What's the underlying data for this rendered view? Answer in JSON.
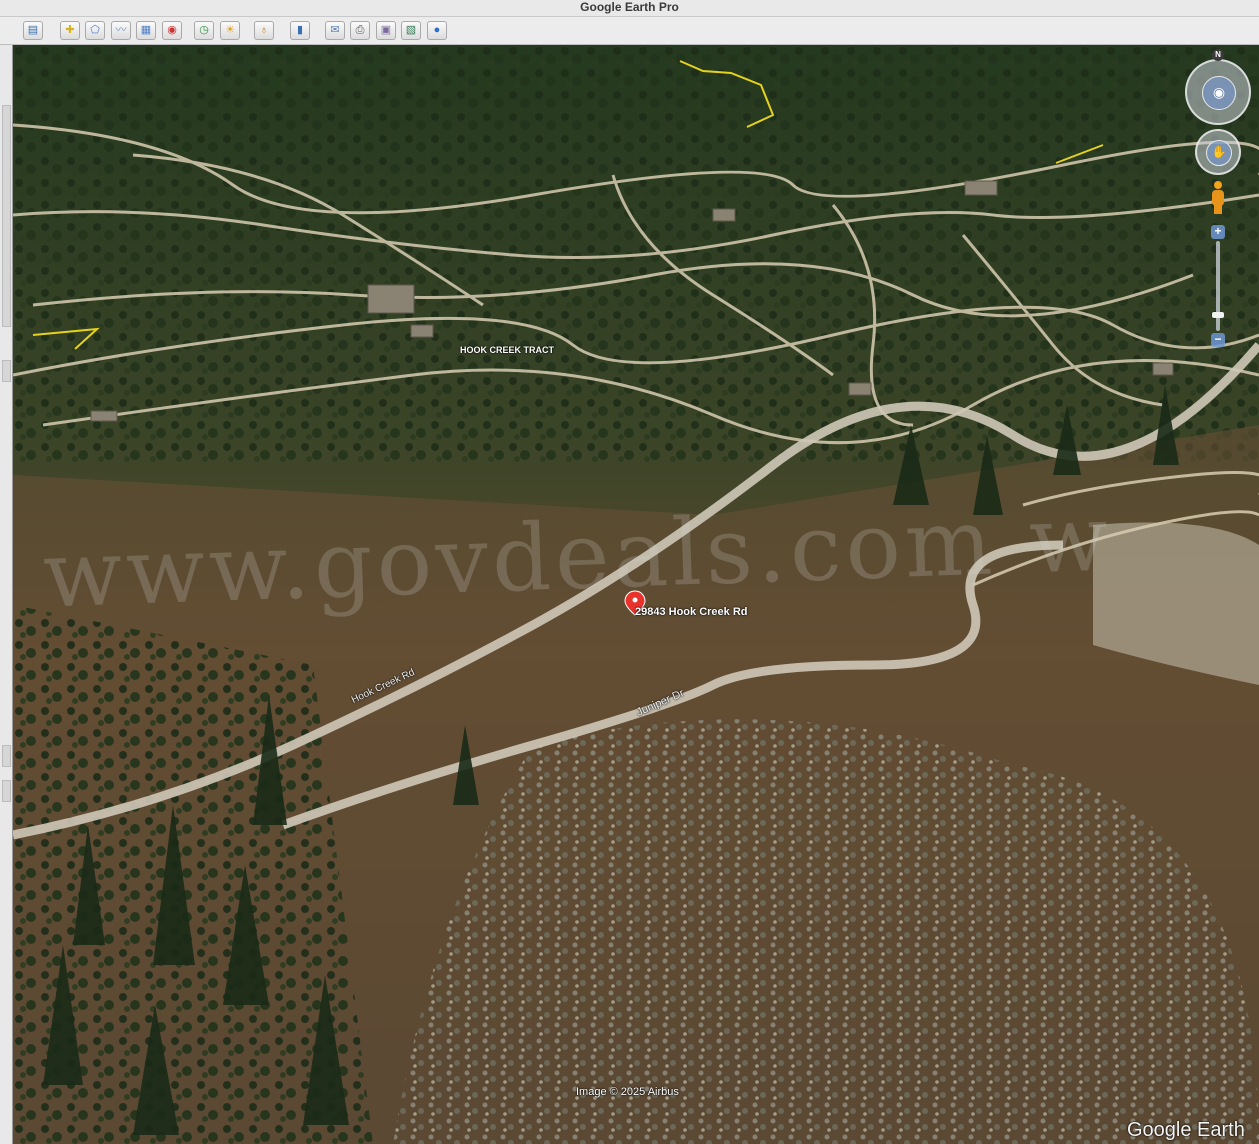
{
  "window": {
    "title": "Google Earth Pro"
  },
  "toolbar": {
    "buttons": [
      {
        "name": "sidebar-toggle-button",
        "icon": "sidebar-icon",
        "glyph": "▤"
      },
      {
        "name": "add-placemark-button",
        "icon": "placemark-icon",
        "glyph": "✚"
      },
      {
        "name": "add-polygon-button",
        "icon": "polygon-icon",
        "glyph": "⬠"
      },
      {
        "name": "add-path-button",
        "icon": "path-icon",
        "glyph": "〰"
      },
      {
        "name": "add-image-overlay-button",
        "icon": "image-overlay-icon",
        "glyph": "▦"
      },
      {
        "name": "record-tour-button",
        "icon": "record-tour-icon",
        "glyph": "◉"
      },
      {
        "name": "historical-imagery-button",
        "icon": "clock-icon",
        "glyph": "◷"
      },
      {
        "name": "sunlight-button",
        "icon": "sun-icon",
        "glyph": "☀"
      },
      {
        "name": "switch-planet-button",
        "icon": "planet-icon",
        "glyph": "♁"
      },
      {
        "name": "ruler-button",
        "icon": "ruler-icon",
        "glyph": "▮"
      },
      {
        "name": "email-button",
        "icon": "envelope-icon",
        "glyph": "✉"
      },
      {
        "name": "print-button",
        "icon": "printer-icon",
        "glyph": "⎙"
      },
      {
        "name": "save-image-button",
        "icon": "save-image-icon",
        "glyph": "▣"
      },
      {
        "name": "view-in-maps-button",
        "icon": "map-icon",
        "glyph": "▧"
      },
      {
        "name": "earth-gallery-button",
        "icon": "globe-icon",
        "glyph": "●"
      }
    ]
  },
  "map": {
    "labels": {
      "tract": "HOOK CREEK TRACT",
      "placemark": "29843 Hook Creek Rd",
      "road_hook_creek": "Hook Creek Rd",
      "road_juniper": "Juniper Dr"
    },
    "watermark": "www.govdeals.com w",
    "attribution": "Image © 2025 Airbus",
    "brand": "Google Earth"
  },
  "navigation": {
    "north_label": "N",
    "zoom_in": "+",
    "zoom_out": "−",
    "zoom_level_fraction": 0.85
  },
  "colors": {
    "placemark": "#e8322c",
    "boundary_line": "#e6d21c",
    "road": "#d8cdb2",
    "nav_blue": "#3f7fd0"
  }
}
